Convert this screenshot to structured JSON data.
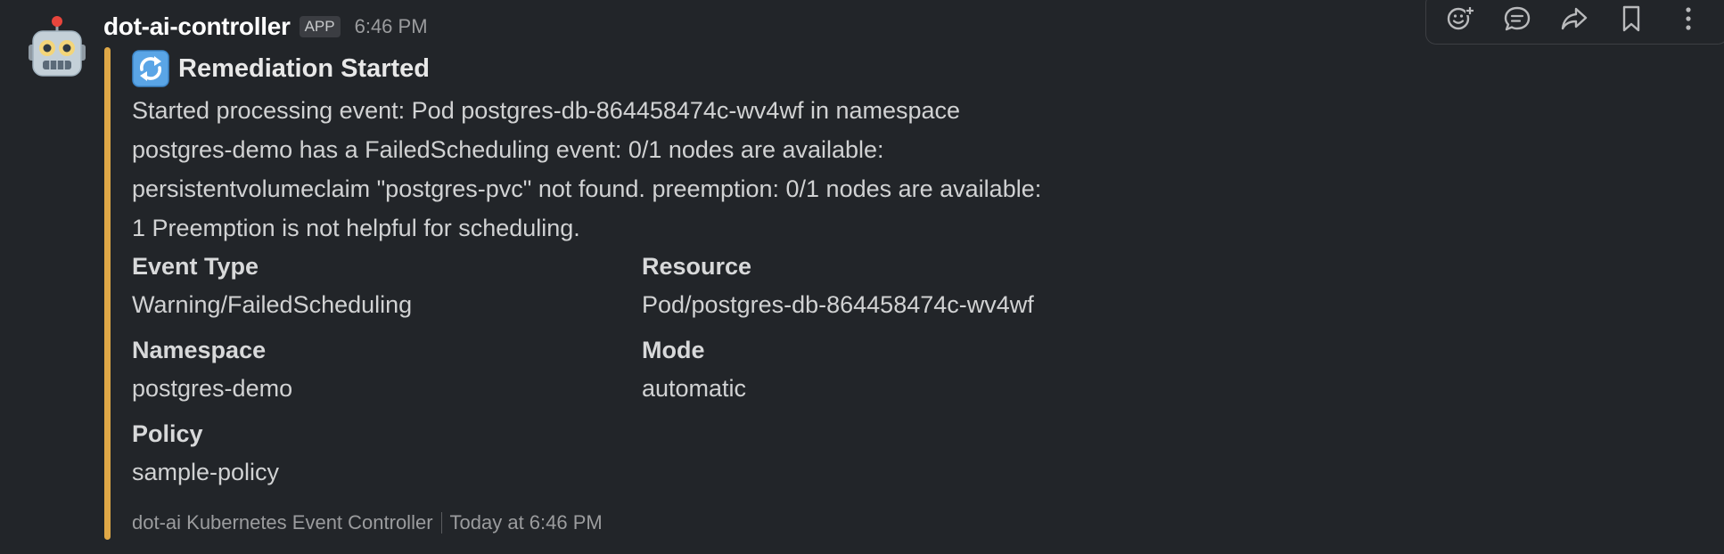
{
  "message": {
    "sender": "dot-ai-controller",
    "badge": "APP",
    "time": "6:46 PM",
    "avatar_icon": "robot-face-icon",
    "attachment": {
      "accent_color": "#dfa847",
      "title_icon": "arrows-counterclockwise-icon",
      "title": "Remediation Started",
      "text_lines": [
        "Started processing event: Pod postgres-db-864458474c-wv4wf in namespace",
        "postgres-demo has a FailedScheduling event: 0/1 nodes are available:",
        "persistentvolumeclaim \"postgres-pvc\" not found. preemption: 0/1 nodes are available:",
        "1 Preemption is not helpful for scheduling."
      ],
      "fields": [
        {
          "title": "Event Type",
          "value": "Warning/FailedScheduling"
        },
        {
          "title": "Resource",
          "value": "Pod/postgres-db-864458474c-wv4wf"
        },
        {
          "title": "Namespace",
          "value": "postgres-demo"
        },
        {
          "title": "Mode",
          "value": "automatic"
        },
        {
          "title": "Policy",
          "value": "sample-policy"
        }
      ],
      "footer": {
        "source": "dot-ai Kubernetes Event Controller",
        "time": "Today at 6:46 PM"
      }
    }
  },
  "message_actions": [
    {
      "icon": "add-reaction-icon"
    },
    {
      "icon": "reply-thread-icon"
    },
    {
      "icon": "share-forward-icon"
    },
    {
      "icon": "bookmark-icon"
    },
    {
      "icon": "more-vertical-icon"
    }
  ]
}
